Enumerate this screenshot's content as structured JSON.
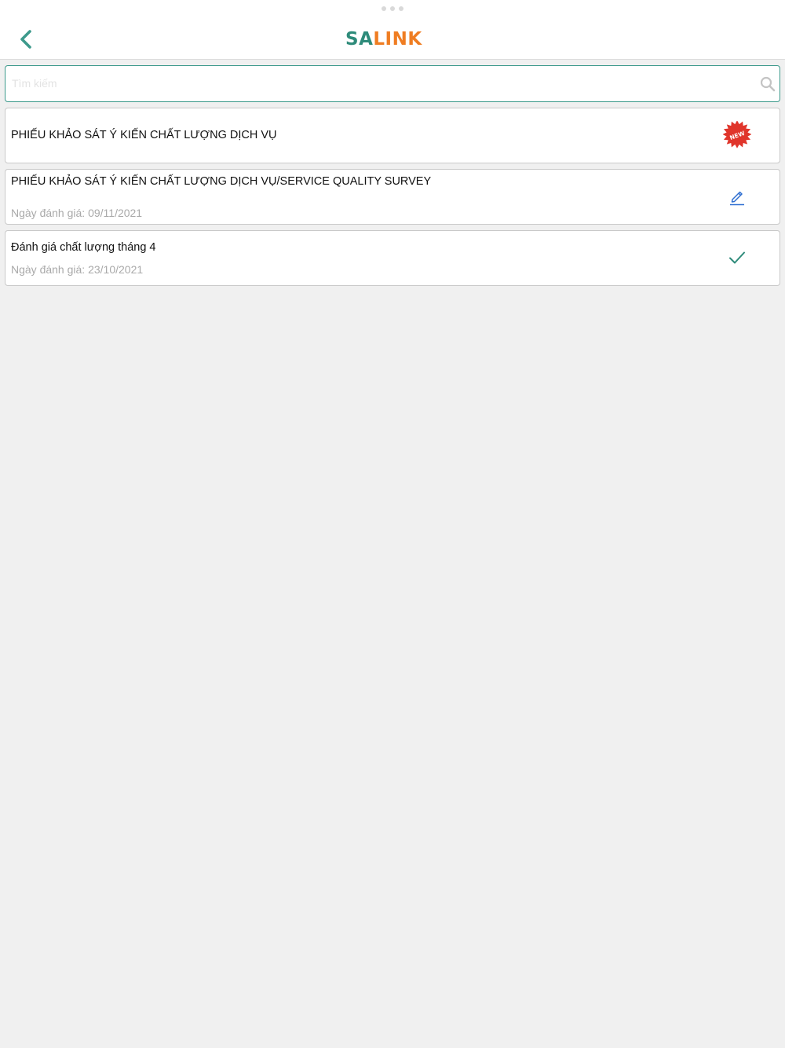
{
  "header": {
    "logo_sa": "SA",
    "logo_link": "LINK"
  },
  "search": {
    "placeholder": "Tìm kiếm",
    "value": ""
  },
  "surveys": [
    {
      "title": "PHIẾU KHẢO SÁT Ý KIẾN CHẤT LƯỢNG DỊCH VỤ",
      "date": "",
      "status_icon": "new-badge-icon",
      "badge_text": "NEW"
    },
    {
      "title": "PHIẾU KHẢO SÁT Ý KIẾN CHẤT LƯỢNG DỊCH VỤ/SERVICE QUALITY SURVEY",
      "date": "Ngày đánh giá: 09/11/2021",
      "status_icon": "pencil-edit-icon"
    },
    {
      "title": "Đánh giá chất lượng tháng 4",
      "date": "Ngày đánh giá: 23/10/2021",
      "status_icon": "checkmark-icon"
    }
  ],
  "colors": {
    "brand_teal": "#2e8b7a",
    "brand_orange": "#ef7d22",
    "new_badge_red": "#e0352b",
    "edit_blue": "#2f6fd1",
    "check_teal": "#2e8b7a",
    "background": "#f0f0f0"
  }
}
